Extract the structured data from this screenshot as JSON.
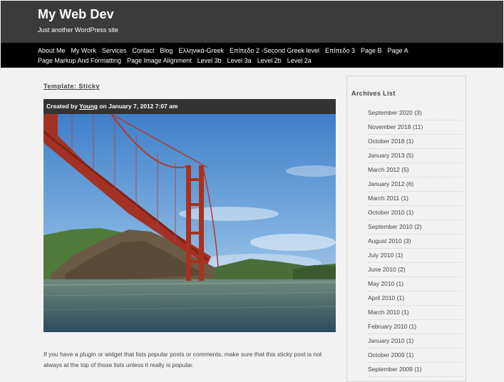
{
  "site": {
    "title": "My Web Dev",
    "description": "Just another WordPress site"
  },
  "nav": {
    "row1": [
      "About Me",
      "My Work",
      "Services",
      "Contact",
      "Blog",
      "Ελληνικά-Greek",
      "Επίπεδο 2 -Second Greek level",
      "Επίπεδο 3",
      "Page B",
      "Page A"
    ],
    "row2": [
      "Page Markup And Formatting",
      "Page Image Alignment",
      "Level 3b",
      "Level 3a",
      "Level 2b",
      "Level 2a"
    ]
  },
  "post": {
    "template_label": "Template: Sticky",
    "meta_prefix": "Created by",
    "author": "Young",
    "meta_date": "on January 7, 2012 7:07 am",
    "image_alt": "Golden Gate Bridge",
    "body": "If you have a plugin or widget that lists popular posts or comments, make sure that this sticky post is not always at the top of those lists unless it really is popular."
  },
  "sidebar": {
    "title": "Archives List",
    "archives": [
      "September 2020 (3)",
      "November 2018 (11)",
      "October 2018 (1)",
      "January 2013 (5)",
      "March 2012 (5)",
      "January 2012 (6)",
      "March 2011 (1)",
      "October 2010 (1)",
      "September 2010 (2)",
      "August 2010 (3)",
      "July 2010 (1)",
      "June 2010 (2)",
      "May 2010 (1)",
      "April 2010 (1)",
      "March 2010 (1)",
      "February 2010 (1)",
      "January 2010 (1)",
      "October 2009 (1)",
      "September 2009 (1)"
    ]
  },
  "colors": {
    "header_bg": "#3b3b3b",
    "nav_bg": "#000000",
    "page_bg": "#f2f2f2",
    "meta_bar_bg": "#333333"
  }
}
